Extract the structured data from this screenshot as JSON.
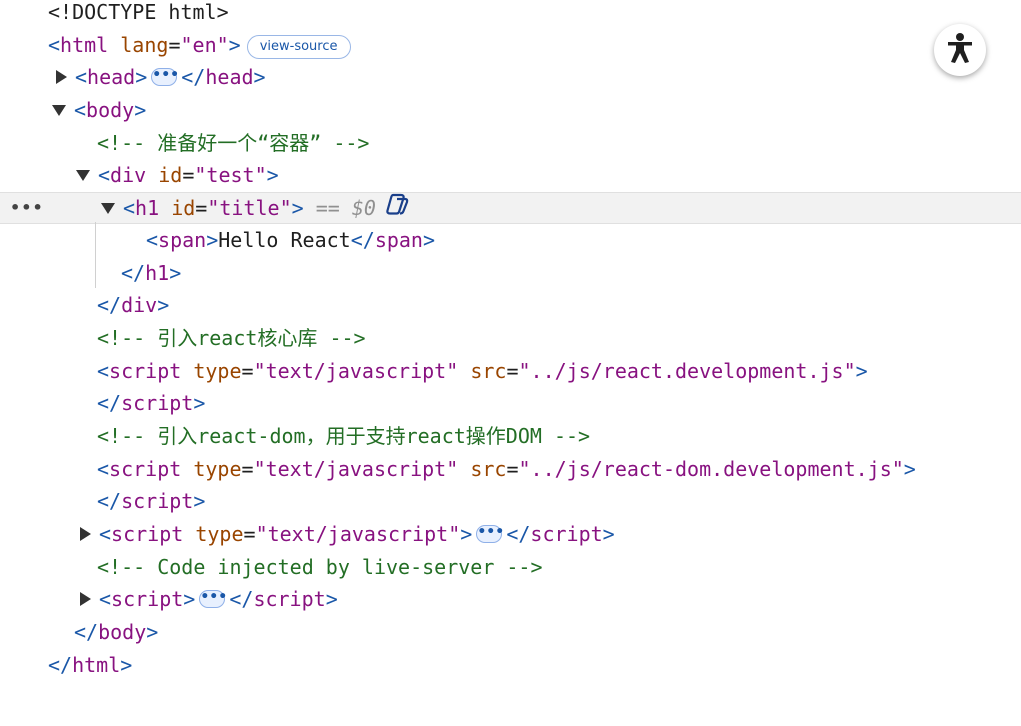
{
  "accent_color": "#1a57a8",
  "view_source_label": "view-source",
  "ellipsis_label": "•••",
  "row_menu_label": "•••",
  "selected_marker": {
    "eq": "==",
    "ref": "$0"
  },
  "lines": {
    "doctype": "<!DOCTYPE html>",
    "html_open": {
      "open": "<",
      "tag": "html",
      "attr": "lang",
      "eq": "=",
      "value": "\"en\"",
      "close": ">"
    },
    "head": {
      "open": "<",
      "tag": "head",
      "close": ">",
      "end_open": "</",
      "end_tag": "head",
      "end_close": ">"
    },
    "body_open": {
      "open": "<",
      "tag": "body",
      "close": ">"
    },
    "comment_container": "<!-- 准备好一个“容器” -->",
    "div_open": {
      "open": "<",
      "tag": "div",
      "attr": "id",
      "eq": "=",
      "value": "\"test\"",
      "close": ">"
    },
    "h1_open": {
      "open": "<",
      "tag": "h1",
      "attr": "id",
      "eq": "=",
      "value": "\"title\"",
      "close": ">"
    },
    "span_line": {
      "open": "<",
      "tag": "span",
      "close": ">",
      "text": "Hello React",
      "end_open": "</",
      "end_tag": "span",
      "end_close": ">"
    },
    "h1_close": {
      "open": "</",
      "tag": "h1",
      "close": ">"
    },
    "div_close": {
      "open": "</",
      "tag": "div",
      "close": ">"
    },
    "comment_react": "<!-- 引入react核心库 -->",
    "script_react": {
      "open": "<",
      "tag": "script",
      "attr1": "type",
      "eq1": "=",
      "value1": "\"text/javascript\"",
      "attr2": "src",
      "eq2": "=",
      "value2": "\"../js/react.development.js\"",
      "close": ">"
    },
    "script_close_1": {
      "open": "</",
      "tag": "script",
      "close": ">"
    },
    "comment_react_dom": "<!-- 引入react-dom，用于支持react操作DOM -->",
    "script_react_dom": {
      "open": "<",
      "tag": "script",
      "attr1": "type",
      "eq1": "=",
      "value1": "\"text/javascript\"",
      "attr2": "src",
      "eq2": "=",
      "value2": "\"../js/react-dom.development.js\"",
      "close": ">"
    },
    "script_close_2": {
      "open": "</",
      "tag": "script",
      "close": ">"
    },
    "script_babel": {
      "open": "<",
      "tag": "script",
      "attr": "type",
      "eq": "=",
      "value": "\"text/javascript\"",
      "close": ">",
      "end_open": "</",
      "end_tag": "script",
      "end_close": ">"
    },
    "comment_live_server": "<!-- Code injected by live-server -->",
    "script_live": {
      "open": "<",
      "tag": "script",
      "close": ">",
      "end_open": "</",
      "end_tag": "script",
      "end_close": ">"
    },
    "body_close": {
      "open": "</",
      "tag": "body",
      "close": ">"
    },
    "html_close": {
      "open": "</",
      "tag": "html",
      "close": ">"
    }
  }
}
